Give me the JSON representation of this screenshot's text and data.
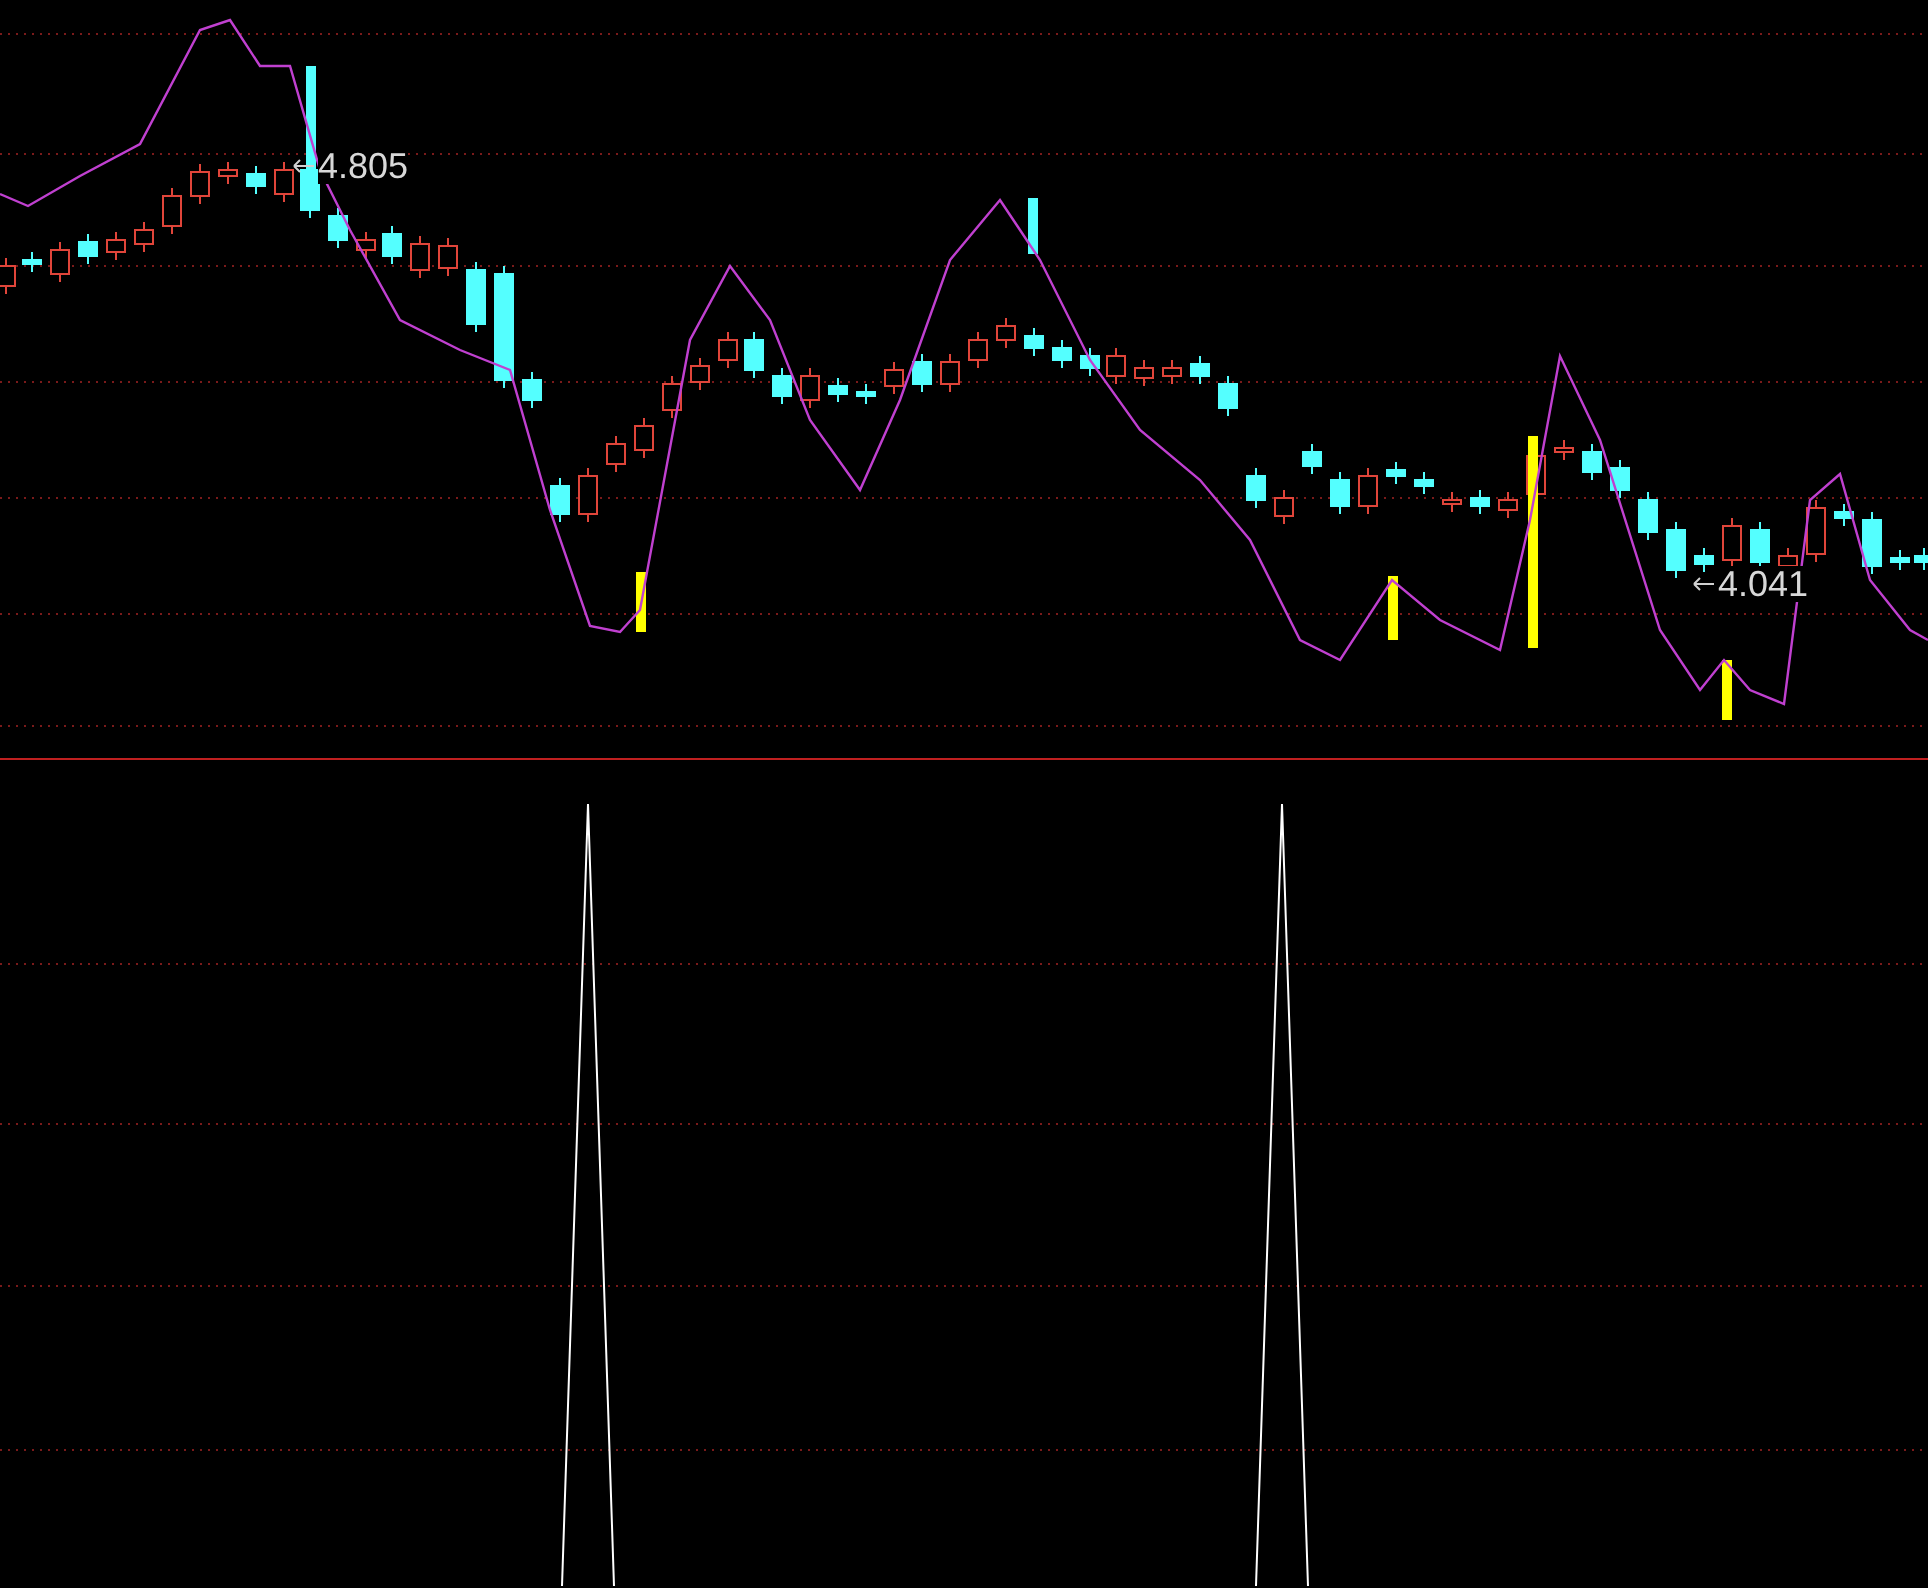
{
  "price_panel": {
    "high_label": "4.805",
    "low_label": "4.041"
  }
}
